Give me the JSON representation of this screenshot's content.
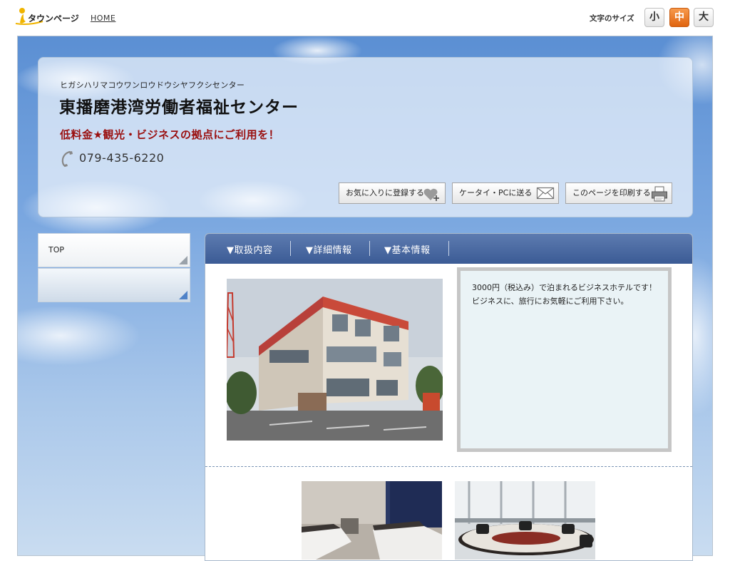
{
  "header": {
    "logo_text": "タウンページ",
    "home_link": "HOME",
    "font_size_label": "文字のサイズ",
    "font_sizes": [
      {
        "label": "小",
        "active": false
      },
      {
        "label": "中",
        "active": true
      },
      {
        "label": "大",
        "active": false
      }
    ]
  },
  "business": {
    "name_kana": "ヒガシハリマコウワンロウドウシヤフクシセンター",
    "name": "東播磨港湾労働者福祉センター",
    "catch_copy": "低料金★観光・ビジネスの拠点にご利用を！",
    "phone": "079-435-6220",
    "phone_icon": "phone-icon"
  },
  "actions": [
    {
      "label": "お気に入りに登録する",
      "icon": "heart-plus-icon"
    },
    {
      "label": "ケータイ・PCに送る",
      "icon": "envelope-icon"
    },
    {
      "label": "このページを印刷する",
      "icon": "printer-icon"
    }
  ],
  "sidebar": {
    "items": [
      {
        "label": "TOP"
      },
      {
        "label": ""
      }
    ]
  },
  "tabs": [
    {
      "label": "▼取扱内容"
    },
    {
      "label": "▼詳細情報"
    },
    {
      "label": "▼基本情報"
    }
  ],
  "main": {
    "description_line1": "3000円（税込み）で泊まれるビジネスホテルです！",
    "description_line2": "ビジネスに、旅行にお気軽にご利用下さい。"
  },
  "colors": {
    "accent_orange": "#e0640f",
    "tab_bar": "#3b5b95",
    "catch_red": "#9a0f0f"
  }
}
